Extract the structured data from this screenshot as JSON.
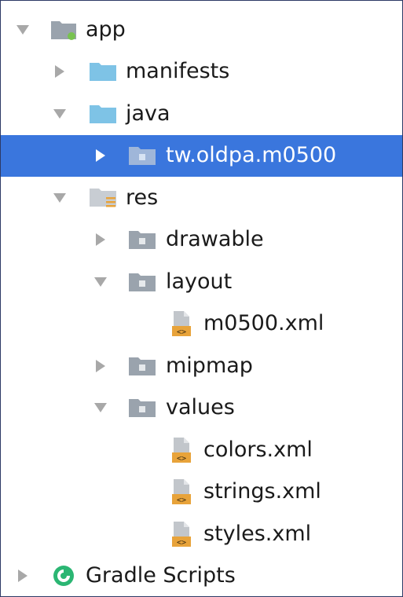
{
  "tree": {
    "items": [
      {
        "label": "app",
        "depth": 0,
        "state": "expanded",
        "icon": "module-folder-icon"
      },
      {
        "label": "manifests",
        "depth": 1,
        "state": "collapsed",
        "icon": "folder-icon"
      },
      {
        "label": "java",
        "depth": 1,
        "state": "expanded",
        "icon": "folder-icon"
      },
      {
        "label": "tw.oldpa.m0500",
        "depth": 2,
        "state": "collapsed",
        "icon": "package-folder-icon",
        "selected": true
      },
      {
        "label": "res",
        "depth": 1,
        "state": "expanded",
        "icon": "resource-folder-icon"
      },
      {
        "label": "drawable",
        "depth": 2,
        "state": "collapsed",
        "icon": "package-folder-icon"
      },
      {
        "label": "layout",
        "depth": 2,
        "state": "expanded",
        "icon": "package-folder-icon"
      },
      {
        "label": "m0500.xml",
        "depth": 3,
        "state": "leaf",
        "icon": "xml-file-icon"
      },
      {
        "label": "mipmap",
        "depth": 2,
        "state": "collapsed",
        "icon": "package-folder-icon"
      },
      {
        "label": "values",
        "depth": 2,
        "state": "expanded",
        "icon": "package-folder-icon"
      },
      {
        "label": "colors.xml",
        "depth": 3,
        "state": "leaf",
        "icon": "xml-file-icon"
      },
      {
        "label": "strings.xml",
        "depth": 3,
        "state": "leaf",
        "icon": "xml-file-icon"
      },
      {
        "label": "styles.xml",
        "depth": 3,
        "state": "leaf",
        "icon": "xml-file-icon"
      },
      {
        "label": "Gradle Scripts",
        "depth": 0,
        "state": "collapsed",
        "icon": "gradle-icon"
      }
    ]
  },
  "colors": {
    "selection": "#3a76dd",
    "folder": "#7ec3e6",
    "package_folder": "#9aa3ad",
    "arrow": "#a8a8a8",
    "xml_orange": "#e8a33a",
    "gradle_green": "#2bb673"
  }
}
